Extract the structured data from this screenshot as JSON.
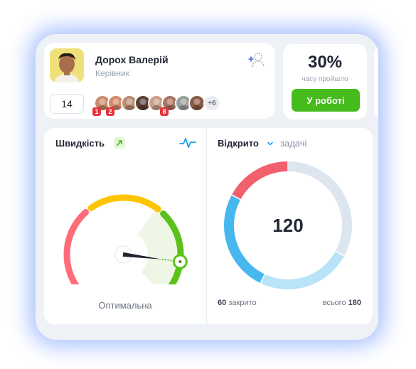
{
  "user": {
    "name": "Дорох Валерій",
    "role": "Керівник",
    "count": "14",
    "team": [
      {
        "badge": "1",
        "color": "#c98b6b"
      },
      {
        "badge": "2",
        "color": "#d28a6a"
      },
      {
        "badge": "",
        "color": "#b98d72"
      },
      {
        "badge": "",
        "color": "#5b4037"
      },
      {
        "badge": "",
        "color": "#caa088"
      },
      {
        "badge": "8",
        "color": "#a87562"
      },
      {
        "badge": "",
        "color": "#9a9f9b"
      },
      {
        "badge": "",
        "color": "#8a5a44"
      }
    ],
    "more_members": "+6"
  },
  "progress": {
    "percent": "30%",
    "caption": "часу пройшло",
    "button_label": "У роботі"
  },
  "speed": {
    "title": "Швидкість",
    "status": "Оптимальна",
    "level": 0.86,
    "colors": {
      "red": "#ff6b78",
      "yellow": "#ffc400",
      "green": "#5cc21a"
    },
    "icons": {
      "trend": "trend-up-icon",
      "pulse": "pulse-icon"
    }
  },
  "open": {
    "title": "Відкрито",
    "subtitle": "задачі",
    "value": "120",
    "closed_value": "60",
    "closed_label": "закрито",
    "total_label": "всього",
    "total_value": "180",
    "colors": {
      "red": "#f2606e",
      "blue": "#47b8ee",
      "light_blue": "#b9e4f8",
      "gray": "#dde6ef"
    }
  }
}
